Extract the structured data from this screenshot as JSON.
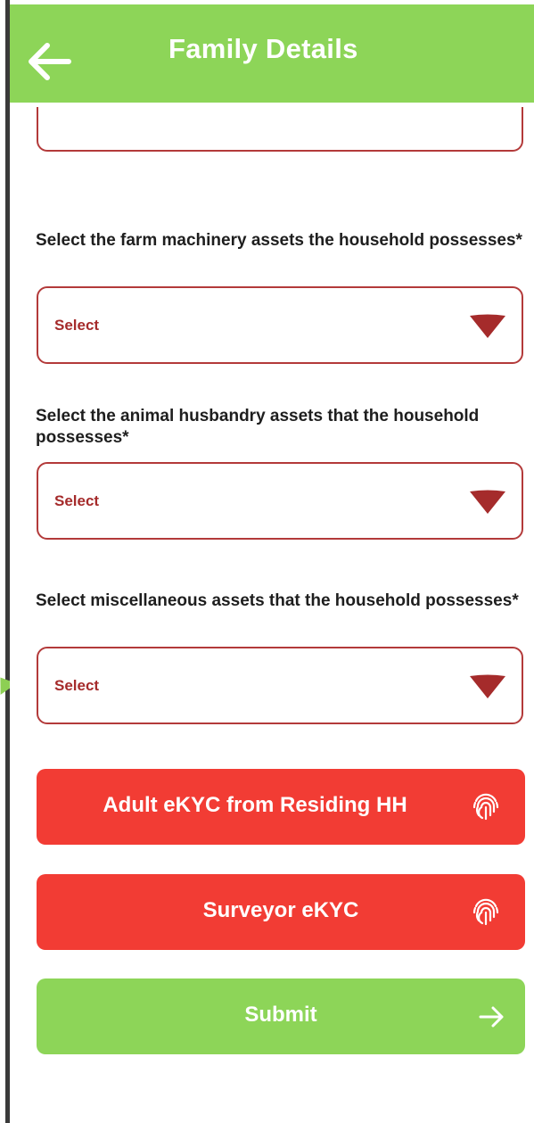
{
  "header": {
    "title": "Family Details",
    "back_icon": "arrow-left-icon",
    "background": "#8dd558"
  },
  "questions": [
    {
      "label": " Select the farm machinery assets the household possesses*",
      "select_value": "Select"
    },
    {
      "label": "Select the animal husbandry assets that the household possesses*",
      "select_value": "Select"
    },
    {
      "label": "Select miscellaneous assets that the household possesses*",
      "select_value": "Select"
    }
  ],
  "buttons": {
    "adult_ekyc": {
      "label": "Adult eKYC from Residing HH",
      "icon": "fingerprint-icon"
    },
    "surveyor_ekyc": {
      "label": "Surveyor eKYC",
      "icon": "fingerprint-icon"
    },
    "submit": {
      "label": "Submit",
      "icon": "arrow-right-icon"
    }
  },
  "colors": {
    "accent_green": "#8dd558",
    "button_red": "#f23c34",
    "field_border": "#b33a3a",
    "caret": "#a52b2b"
  }
}
